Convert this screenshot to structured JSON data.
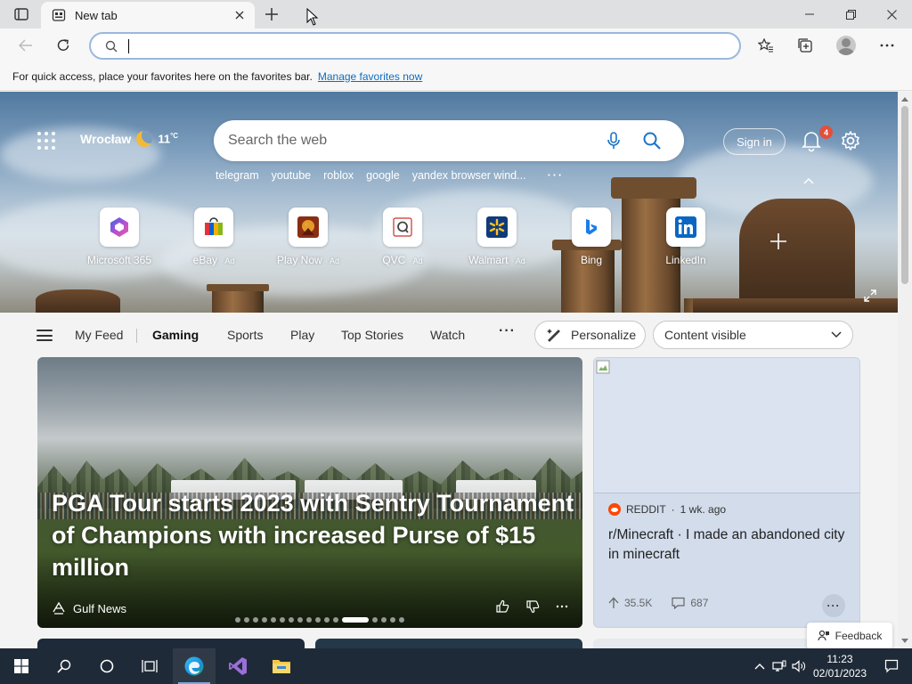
{
  "browser": {
    "tab": {
      "title": "New tab"
    },
    "address": {
      "value": "",
      "placeholder": ""
    },
    "favorites_bar": {
      "message": "For quick access, place your favorites here on the favorites bar.",
      "link": "Manage favorites now"
    }
  },
  "hero": {
    "weather": {
      "city": "Wrocław",
      "temp": "11",
      "unit": "°C"
    },
    "search": {
      "placeholder": "Search the web"
    },
    "trending": [
      "telegram",
      "youtube",
      "roblox",
      "google",
      "yandex browser wind..."
    ],
    "signin_label": "Sign in",
    "notification_count": "4",
    "tiles": [
      {
        "name": "Microsoft 365",
        "ad": ""
      },
      {
        "name": "eBay",
        "ad": "· Ad"
      },
      {
        "name": "Play Now",
        "ad": "· Ad"
      },
      {
        "name": "QVC",
        "ad": "· Ad"
      },
      {
        "name": "Walmart",
        "ad": "· Ad"
      },
      {
        "name": "Bing",
        "ad": ""
      },
      {
        "name": "LinkedIn",
        "ad": ""
      }
    ]
  },
  "feed": {
    "nav": [
      "My Feed",
      "Gaming",
      "Sports",
      "Play",
      "Top Stories",
      "Watch"
    ],
    "active_nav": "Gaming",
    "personalize_label": "Personalize",
    "content_select": "Content visible",
    "main_card": {
      "headline": "PGA Tour starts 2023 with Sentry Tournament of Champions with increased Purse of $15 million",
      "source": "Gulf News",
      "slide_count": 17,
      "active_slide": 12
    },
    "side_card": {
      "source": "REDDIT",
      "age": "1 wk. ago",
      "title": "r/Minecraft · I made an abandoned city in minecraft",
      "upvotes": "35.5K",
      "comments": "687"
    },
    "feedback_label": "Feedback"
  },
  "taskbar": {
    "time": "11:23",
    "date": "02/01/2023"
  },
  "colors": {
    "accent": "#0f6cbd",
    "taskbar": "#1f2a38",
    "badge": "#e1503d"
  }
}
